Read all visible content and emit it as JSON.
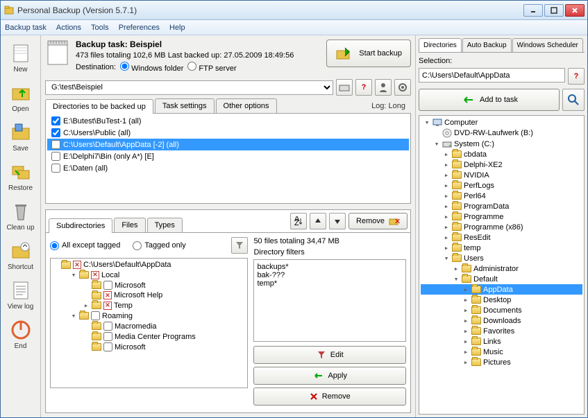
{
  "window": {
    "title": "Personal Backup (Version 5.7.1)"
  },
  "menu": {
    "backup_task": "Backup task",
    "actions": "Actions",
    "tools": "Tools",
    "preferences": "Preferences",
    "help": "Help"
  },
  "toolbar": {
    "new": "New",
    "open": "Open",
    "save": "Save",
    "restore": "Restore",
    "cleanup": "Clean up",
    "shortcut": "Shortcut",
    "viewlog": "View log",
    "end": "End"
  },
  "task": {
    "title": "Backup task: Beispiel",
    "summary": "473 files totaling 102,6 MB   Last backed up:  27.05.2009 18:49:56",
    "dest_label": "Destination:",
    "dest_win": "Windows folder",
    "dest_ftp": "FTP server",
    "start": "Start backup",
    "path": "G:\\test\\Beispiel"
  },
  "tabs": {
    "dirs": "Directories to be backed up",
    "task": "Task settings",
    "other": "Other options",
    "log": "Log: Long"
  },
  "dirs": [
    {
      "checked": true,
      "label": "E:\\Butest\\BuTest-1 (all)"
    },
    {
      "checked": true,
      "label": "C:\\Users\\Public (all)"
    },
    {
      "checked": false,
      "label": "C:\\Users\\Default\\AppData [-2] (all)",
      "sel": true
    },
    {
      "checked": false,
      "label": "E:\\Delphi7\\Bin (only A*) [E]"
    },
    {
      "checked": false,
      "label": "E:\\Daten (all)"
    }
  ],
  "subtabs": {
    "sub": "Subdirectories",
    "files": "Files",
    "types": "Types",
    "remove": "Remove"
  },
  "filter": {
    "all": "All except tagged",
    "tagged": "Tagged only"
  },
  "tree": {
    "root": "C:\\Users\\Default\\AppData",
    "nodes": [
      {
        "indent": 1,
        "tw": "▾",
        "x": true,
        "label": "Local"
      },
      {
        "indent": 2,
        "tw": "",
        "x": false,
        "label": "Microsoft"
      },
      {
        "indent": 2,
        "tw": "",
        "x": true,
        "label": "Microsoft Help"
      },
      {
        "indent": 2,
        "tw": "▸",
        "x": true,
        "label": "Temp"
      },
      {
        "indent": 1,
        "tw": "▾",
        "x": false,
        "label": "Roaming"
      },
      {
        "indent": 2,
        "tw": "",
        "x": false,
        "label": "Macromedia"
      },
      {
        "indent": 2,
        "tw": "",
        "x": false,
        "label": "Media Center Programs"
      },
      {
        "indent": 2,
        "tw": "",
        "x": false,
        "label": "Microsoft"
      }
    ]
  },
  "right_info": {
    "summary": "50 files totaling 34,47 MB",
    "filters_label": "Directory filters",
    "filters": [
      "backups*",
      "bak-???",
      "temp*"
    ],
    "edit": "Edit",
    "apply": "Apply",
    "remove": "Remove"
  },
  "rpanel": {
    "tabs": {
      "dirs": "Directories",
      "auto": "Auto Backup",
      "sched": "Windows Scheduler"
    },
    "sel_label": "Selection:",
    "sel_value": "C:\\Users\\Default\\AppData",
    "add": "Add to task",
    "tree": [
      {
        "indent": 0,
        "tw": "▾",
        "icon": "computer",
        "label": "Computer"
      },
      {
        "indent": 1,
        "tw": "",
        "icon": "disc",
        "label": "DVD-RW-Laufwerk (B:)"
      },
      {
        "indent": 1,
        "tw": "▾",
        "icon": "drive",
        "label": "System (C:)"
      },
      {
        "indent": 2,
        "tw": "▸",
        "icon": "folder",
        "label": "cbdata"
      },
      {
        "indent": 2,
        "tw": "▸",
        "icon": "folder",
        "label": "Delphi-XE2"
      },
      {
        "indent": 2,
        "tw": "▸",
        "icon": "folder",
        "label": "NVIDIA"
      },
      {
        "indent": 2,
        "tw": "▸",
        "icon": "folder",
        "label": "PerfLogs"
      },
      {
        "indent": 2,
        "tw": "▸",
        "icon": "folder",
        "label": "Perl64"
      },
      {
        "indent": 2,
        "tw": "▸",
        "icon": "folder",
        "label": "ProgramData"
      },
      {
        "indent": 2,
        "tw": "▸",
        "icon": "folder",
        "label": "Programme"
      },
      {
        "indent": 2,
        "tw": "▸",
        "icon": "folder",
        "label": "Programme (x86)"
      },
      {
        "indent": 2,
        "tw": "▸",
        "icon": "folder",
        "label": "ResEdit"
      },
      {
        "indent": 2,
        "tw": "▸",
        "icon": "folder",
        "label": "temp"
      },
      {
        "indent": 2,
        "tw": "▾",
        "icon": "folder",
        "label": "Users"
      },
      {
        "indent": 3,
        "tw": "▸",
        "icon": "folder",
        "label": "Administrator"
      },
      {
        "indent": 3,
        "tw": "▾",
        "icon": "folder",
        "label": "Default"
      },
      {
        "indent": 4,
        "tw": "▸",
        "icon": "folder",
        "label": "AppData",
        "sel": true
      },
      {
        "indent": 4,
        "tw": "▸",
        "icon": "folder",
        "label": "Desktop"
      },
      {
        "indent": 4,
        "tw": "▸",
        "icon": "folder",
        "label": "Documents"
      },
      {
        "indent": 4,
        "tw": "▸",
        "icon": "folder",
        "label": "Downloads"
      },
      {
        "indent": 4,
        "tw": "▸",
        "icon": "folder",
        "label": "Favorites"
      },
      {
        "indent": 4,
        "tw": "▸",
        "icon": "folder",
        "label": "Links"
      },
      {
        "indent": 4,
        "tw": "▸",
        "icon": "folder",
        "label": "Music"
      },
      {
        "indent": 4,
        "tw": "▸",
        "icon": "folder",
        "label": "Pictures"
      }
    ]
  }
}
